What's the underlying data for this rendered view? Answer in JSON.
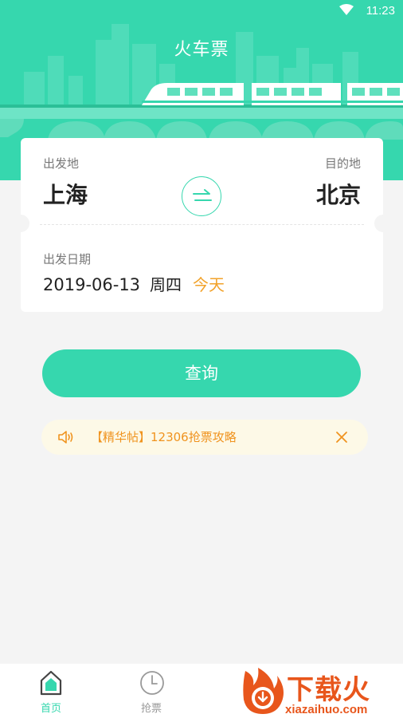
{
  "status_bar": {
    "time": "11:23"
  },
  "header": {
    "title": "火车票"
  },
  "trip": {
    "from_label": "出发地",
    "from_city": "上海",
    "to_label": "目的地",
    "to_city": "北京",
    "date_label": "出发日期",
    "date": "2019-06-13",
    "weekday": "周四",
    "today": "今天"
  },
  "query_button": {
    "label": "查询"
  },
  "notice": {
    "text": "【精华帖】12306抢票攻略"
  },
  "bottom_nav": {
    "items": [
      {
        "label": "首页"
      },
      {
        "label": "抢票"
      }
    ]
  },
  "watermark": {
    "text": "下载火",
    "sub": "xiazaihuo.com"
  },
  "colors": {
    "primary": "#36d7ae",
    "accent": "#f2a22a",
    "notice_bg": "#fdf9e7",
    "watermark": "#e8561c"
  },
  "icons": [
    "wifi-icon",
    "swap-icon",
    "speaker-icon",
    "close-icon",
    "home-icon",
    "clock-icon",
    "flame-logo-icon"
  ]
}
